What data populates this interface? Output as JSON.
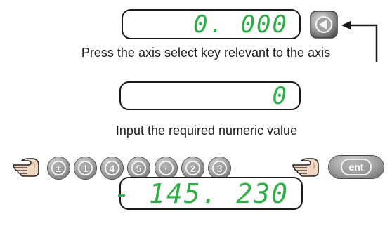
{
  "step1": {
    "display_value": "0. 000",
    "instruction": "Press the axis select key relevant to the axis"
  },
  "step2": {
    "display_value": "0",
    "instruction": "Input the required numeric value",
    "key_sequence": [
      "±",
      "1",
      "4",
      "5",
      "·",
      "2",
      "3"
    ],
    "enter_key": "ent"
  },
  "step3": {
    "display_value": "- 145. 230"
  },
  "colors": {
    "readout_green": "#2fae48",
    "display_border": "#1a1a1a",
    "key_grey": "#9a9a9a"
  },
  "icons": {
    "axis_key": "left-triangle-icon",
    "pointer": "pointing-hand-icon",
    "arrow": "pointer-arrow-icon"
  }
}
